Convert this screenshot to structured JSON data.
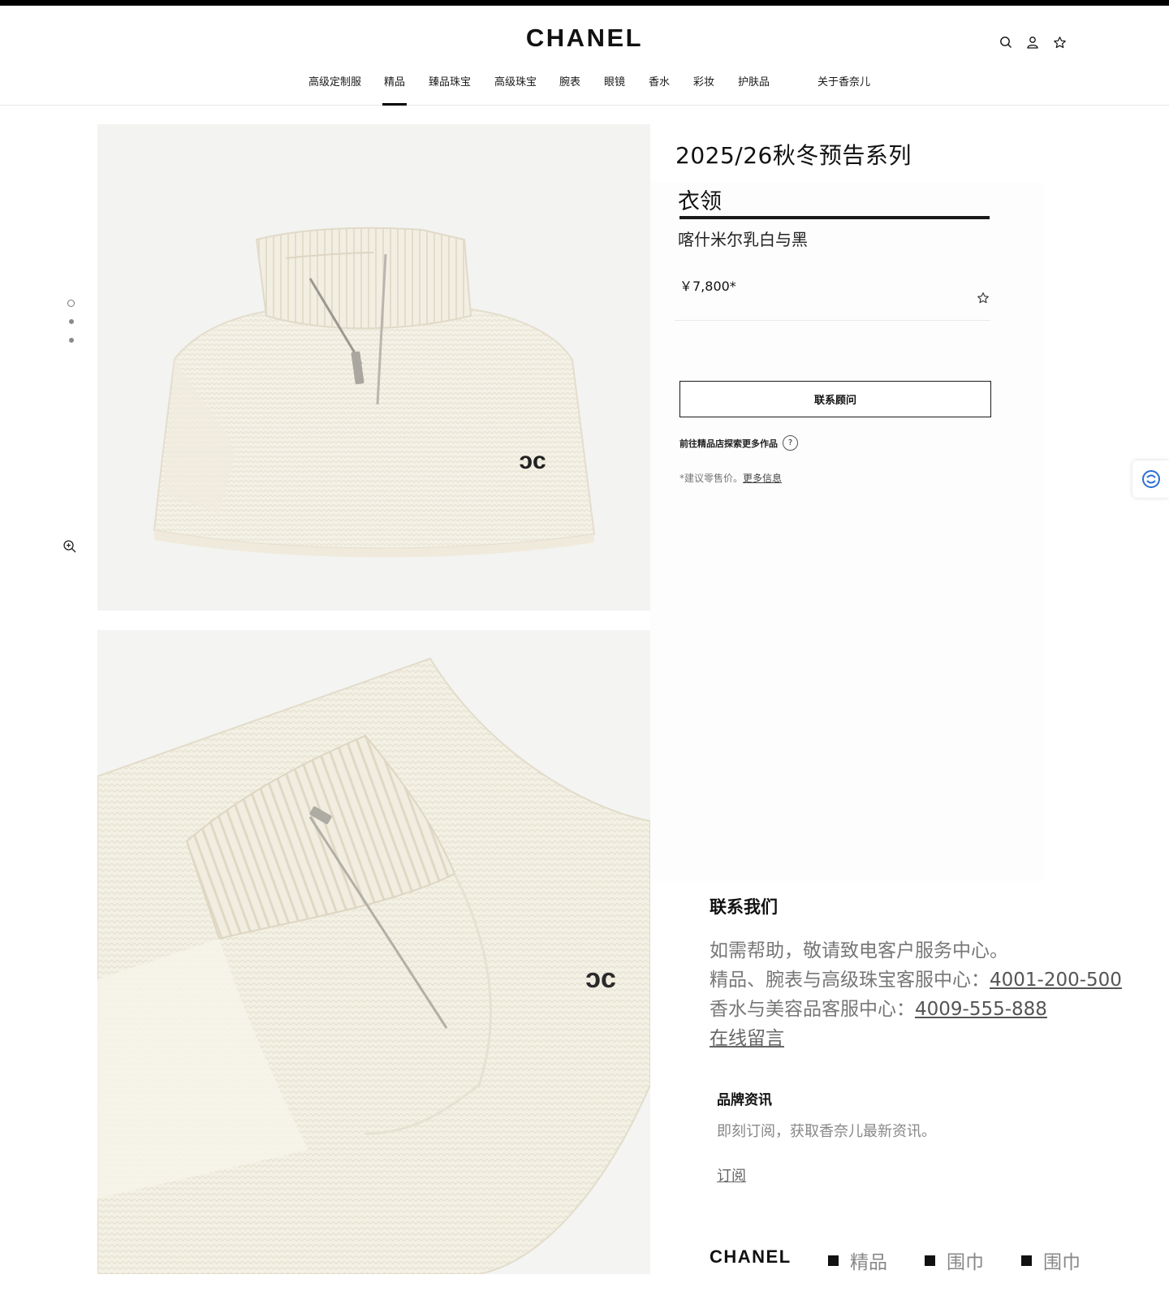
{
  "brand": {
    "logo": "CHANEL"
  },
  "header": {
    "icons": [
      "search-icon",
      "account-icon",
      "wishlist-star-icon"
    ],
    "nav": [
      {
        "label": "高级定制服"
      },
      {
        "label": "精品"
      },
      {
        "label": "臻品珠宝"
      },
      {
        "label": "高级珠宝"
      },
      {
        "label": "腕表"
      },
      {
        "label": "眼镜"
      },
      {
        "label": "香水"
      },
      {
        "label": "彩妆"
      },
      {
        "label": "护肤品"
      },
      {
        "label": "关于香奈儿"
      }
    ],
    "active_nav": "精品"
  },
  "gallery": {
    "images": 3,
    "active_index": 0,
    "zoom_icon": "zoom-in-icon",
    "logo_mark": "CC"
  },
  "product": {
    "collection": "2025/26秋冬预告系列",
    "name": "衣领",
    "color": "喀什米尔乳白与黑",
    "price": "￥7,800*",
    "contact_button": "联系顾问",
    "explore_link": "前往精品店探索更多作品",
    "help_mark": "?",
    "note_prefix": "*建议零售价。",
    "note_link": "更多信息"
  },
  "footer": {
    "contact_title": "联系我们",
    "help_text": "如需帮助，敬请致电客户服务中心。",
    "fashion_label": "精品、腕表与高级珠宝客服中心：",
    "fashion_phone": "4001-200-500",
    "beauty_label": "香水与美容品客服中心：",
    "beauty_phone": "4009-555-888",
    "online_message": "在线留言",
    "news_title": "品牌资讯",
    "news_text": "即刻订阅，获取香奈儿最新资讯。",
    "subscribe": "订阅",
    "breadcrumb": [
      "精品",
      "围巾",
      "围巾"
    ]
  },
  "colors": {
    "accent": "#000000",
    "image_bg": "#f3f3f1",
    "knit": "#f4f1e6",
    "muted_text": "#777777"
  }
}
